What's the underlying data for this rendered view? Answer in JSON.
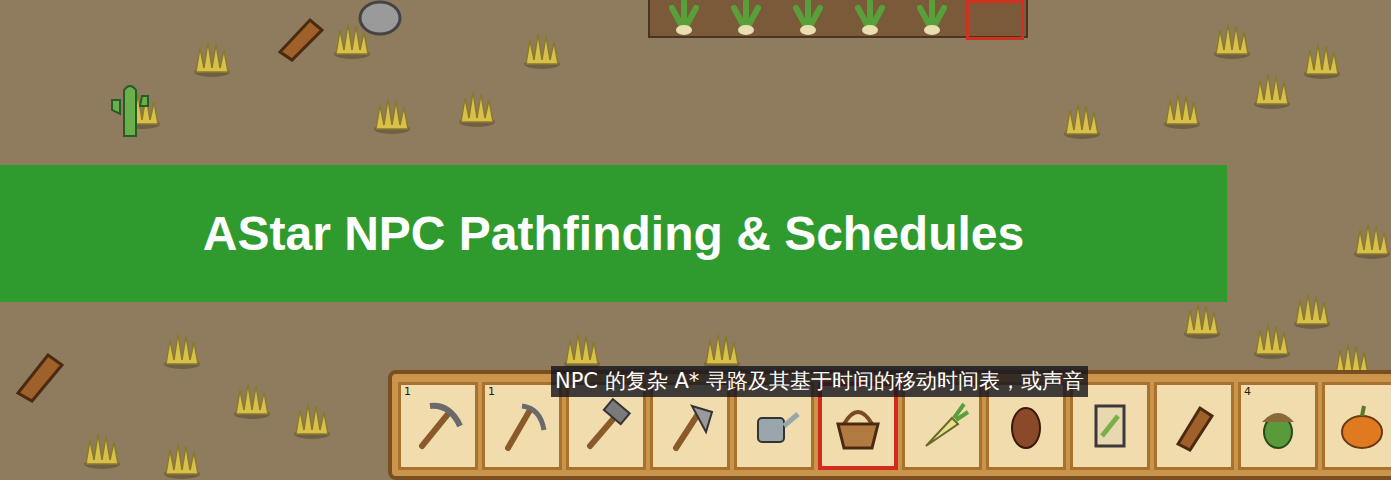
{
  "banner": {
    "title": "AStar NPC Pathfinding & Schedules"
  },
  "subtitle": "NPC 的复杂 A* 寻路及其基于时间的移动时间表，或声音",
  "hotbar": [
    {
      "kind": "pickaxe",
      "count": "1",
      "selected": false
    },
    {
      "kind": "scythe",
      "count": "1",
      "selected": false
    },
    {
      "kind": "hammer",
      "selected": false
    },
    {
      "kind": "axe",
      "selected": false
    },
    {
      "kind": "watering-can",
      "selected": false
    },
    {
      "kind": "basket",
      "selected": true
    },
    {
      "kind": "parsnip",
      "selected": false
    },
    {
      "kind": "pinecone",
      "selected": false
    },
    {
      "kind": "seed-packet",
      "selected": false
    },
    {
      "kind": "wood",
      "selected": false
    },
    {
      "kind": "acorn",
      "count": "4",
      "selected": false
    },
    {
      "kind": "pumpkin",
      "selected": false
    }
  ]
}
